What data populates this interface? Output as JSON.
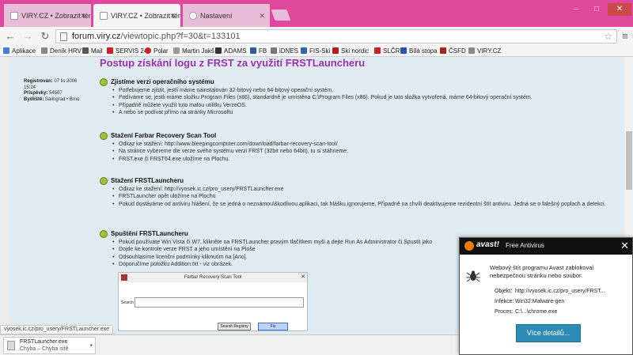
{
  "browser": {
    "tabs": [
      {
        "label": "VIRY.CZ • Zobrazit téma -"
      },
      {
        "label": "VIRY.CZ • Zobrazit téma -"
      },
      {
        "label": "Nastavení"
      }
    ],
    "window_controls": {
      "minimize": "–",
      "maximize": "□",
      "close": "✕"
    },
    "url_host": "forum.viry.cz",
    "url_path": "/viewtopic.php?f=30&t=133101",
    "bookmarks": [
      {
        "label": "Aplikace",
        "icon": "apps-grid-icon",
        "color": "#4a7cd4"
      },
      {
        "label": "Deník HRV",
        "icon": "page-icon",
        "color": "#888888"
      },
      {
        "label": "Mail",
        "icon": "mail-icon",
        "color": "#555555"
      },
      {
        "label": "SERVIS 24",
        "icon": "bank-icon",
        "color": "#cc2222"
      },
      {
        "label": "Polar",
        "icon": "polar-icon",
        "color": "#d22222"
      },
      {
        "label": "Martin Jakš",
        "icon": "page-icon",
        "color": "#999999"
      },
      {
        "label": "ADAMS",
        "icon": "page-icon",
        "color": "#333333"
      },
      {
        "label": "FB",
        "icon": "facebook-icon",
        "color": "#3b5998"
      },
      {
        "label": "iDNES",
        "icon": "page-icon",
        "color": "#777777"
      },
      {
        "label": "FIS-Ski",
        "icon": "ski-icon",
        "color": "#3366aa"
      },
      {
        "label": "Ski nordic",
        "icon": "ski-icon",
        "color": "#aa2222"
      },
      {
        "label": "SLČR",
        "icon": "page-icon",
        "color": "#cc2222"
      },
      {
        "label": "Bílá stopa",
        "icon": "page-icon",
        "color": "#2255aa"
      },
      {
        "label": "ČSFD",
        "icon": "page-icon",
        "color": "#aa2222"
      },
      {
        "label": "VIRY.CZ",
        "icon": "page-icon",
        "color": "#888888"
      }
    ]
  },
  "user": {
    "registered_label": "Registrován:",
    "registered_value": "07 lis 2006 15:24",
    "posts_label": "Příspěvky:",
    "posts_value": "54507",
    "location_label": "Bydliště:",
    "location_value": "Salingrad • Brno"
  },
  "post": {
    "title": "Postup získání logu z FRST za využití FRSTLauncheru",
    "sections": [
      {
        "title": "Zjistíme verzi operačního systému",
        "items": [
          "Potřebujeme zjistit, jestli máme nainstalován 32-bitový nebo 64-bitový operační systém.",
          "Podíváme se, jestli máme složku Program Files (x86), standardně je umístěna C:\\Program Files (x86). Pokud je tato složka vytvořená, máme 64-bitový operační systém.",
          "Případně můžete využít tuto malou utilitku VerzeOS.",
          "A nebo se podívat přímo na stránky Microsoftu"
        ]
      },
      {
        "title": "Stažení Farbar Recovery Scan Tool",
        "items": [
          "Odkaz ke stažení: http://www.bleepingcomputer.com/download/farbar-recovery-scan-tool/",
          "Na stránce vybereme dle verze svého systému verzi FRST (32bit nebo 64bit), tu si stáhneme.",
          "FRST.exe či FRST64.exe uložíme na Plochu."
        ]
      },
      {
        "title": "Stažení FRSTLauncheru",
        "items": [
          "Odkaz ke stažení: http://vyosek.ic.cz/pro_usery/FRSTLauncher.exe",
          "FRSTLauncher opět uložíme na Plochu",
          "Pokud dostáváme od antiviru hlášení, že se jedná o neznámou\\škodlivou aplikaci, tak hlášku ignorujeme. Případně na chvíli deaktivujeme rezidentní štít antiviru. Jedná se o falešný poplach a detekci."
        ]
      },
      {
        "title": "Spuštění FRSTLauncheru",
        "items": [
          "Pokud používáte Win Vista či W7, klikněte na FRSTLauncher pravým tlačítkem myši a dejte Run As Administrator či Spustit jako",
          "Dojde ke kontrole verze FRST a jeho umístění na Ploše",
          "Odsouhlasíme licenční podmínky kliknutím na [Ano].",
          "Doporučíme položku Addition.txt - viz obrázek."
        ]
      }
    ],
    "frst_window": {
      "title": "Farbar Recovery Scan Tool",
      "search_label": "Search",
      "scan_button": "Search Registry",
      "fix_button": "Fix"
    }
  },
  "status_url": "vyosek.ic.cz/pro_usery/FRSTLauncher.exe",
  "download": {
    "file": "FRSTLauncher.exe",
    "status": "Chyba – Chyba sítě"
  },
  "avast": {
    "brand": "avast!",
    "product": "Free Antivirus",
    "message": "Webový štít programu Avast zablokoval nebezpečnou stránku nebo soubor.",
    "object_label": "Objekt:",
    "object_value": "http://vyosek.ic.cz/pro_usery/FRST...",
    "infection_label": "Infekce:",
    "infection_value": "Win32:Malware-gen",
    "process_label": "Proces:",
    "process_value": "C:\\...\\chrome.exe",
    "details_button": "Více detailů...",
    "accent": "#f07b00",
    "button_color": "#2e8bb3"
  },
  "colors": {
    "window_frame": "#e0489e",
    "post_background": "#e1ebf2",
    "title_color": "#9b30b0",
    "link": "#105289"
  }
}
